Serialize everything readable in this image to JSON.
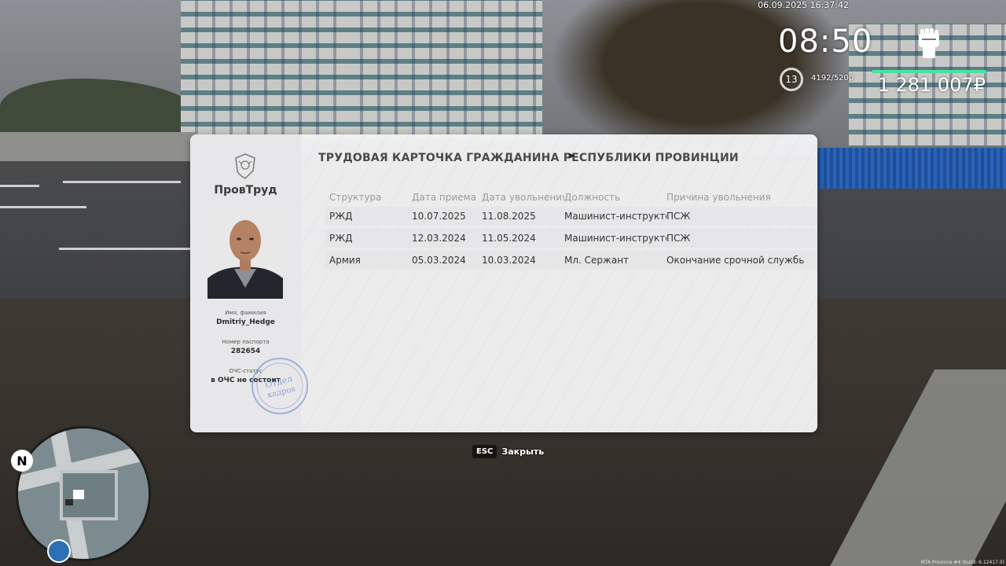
{
  "hud": {
    "datetime": "06.09.2025 16:37:42",
    "clock": "08:50",
    "level": "13",
    "experience": "4192/5200",
    "money": "1 281 007₽",
    "icons": {
      "fist": "fist-icon"
    },
    "colors": {
      "exp_bar": "#4be0a0"
    }
  },
  "card": {
    "org_name": "ПровТруд",
    "title": "ТРУДОВАЯ КАРТОЧКА ГРАЖДАНИНА РЕСПУБЛИКИ ПРОВИНЦИИ",
    "name_label": "Имя, фамилия",
    "name_value": "Dmitriy_Hedge",
    "passport_label": "Номер паспорта",
    "passport_value": "282654",
    "ochs_label": "ОЧС-статус",
    "ochs_value": "в ОЧС не состоит",
    "stamp_text": [
      "Отдел",
      "кадров"
    ],
    "columns": [
      "Структура",
      "Дата приема",
      "Дата увольнения",
      "Должность",
      "Причина увольнения"
    ],
    "rows": [
      [
        "РЖД",
        "10.07.2025",
        "11.08.2025",
        "Машинист-инструктор",
        "ПСЖ"
      ],
      [
        "РЖД",
        "12.03.2024",
        "11.05.2024",
        "Машинист-инструктор",
        "ПСЖ"
      ],
      [
        "Армия",
        "05.03.2024",
        "10.03.2024",
        "Мл. Сержант",
        "Окончание срочной службы."
      ]
    ]
  },
  "close": {
    "key": "ESC",
    "label": "Закрыть"
  },
  "minimap": {
    "north": "N"
  },
  "footer": {
    "build": "MTA Province #4 (build: 6.12417.0)"
  }
}
